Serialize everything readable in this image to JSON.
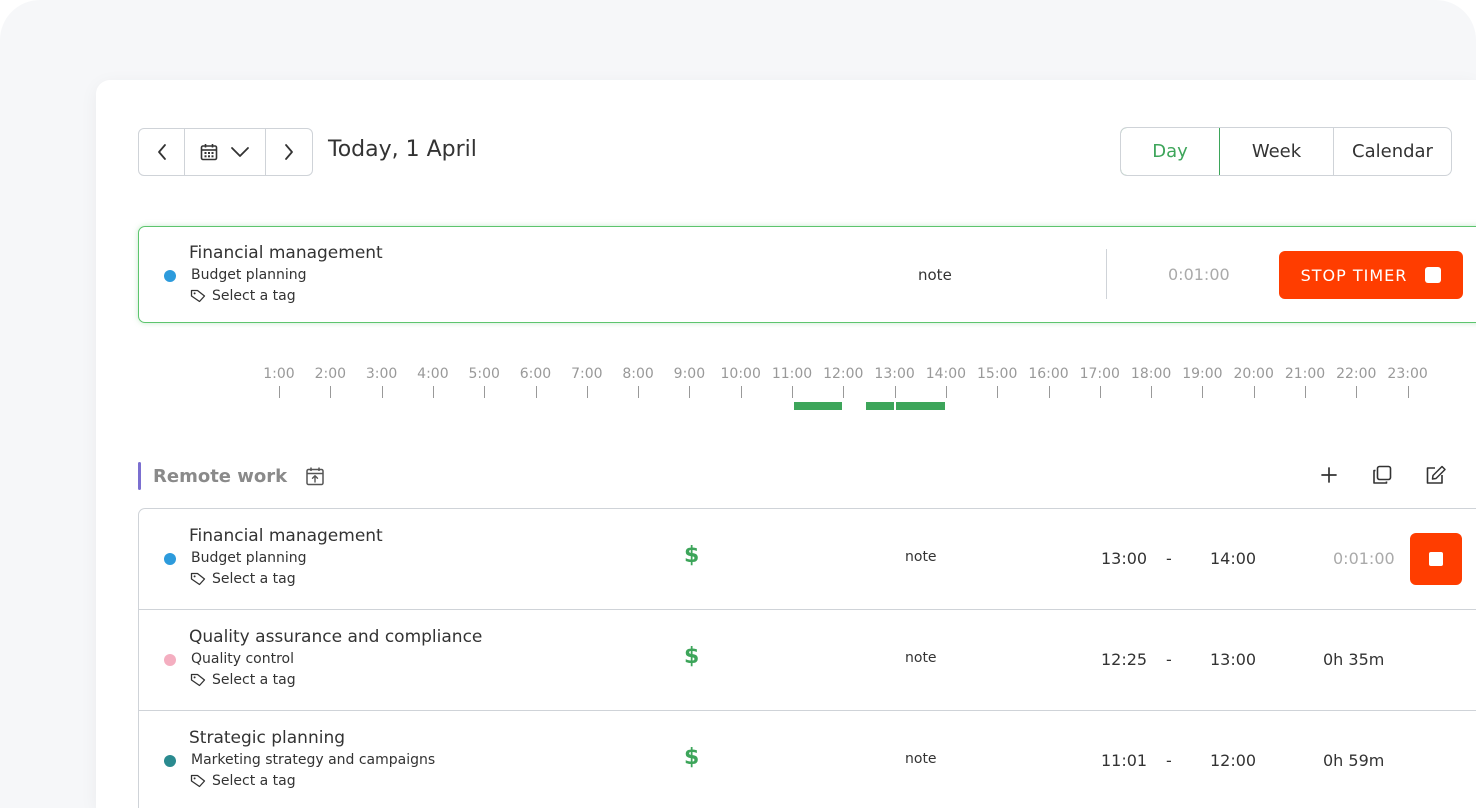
{
  "header": {
    "date_label": "Today, 1 April",
    "views": [
      "Day",
      "Week",
      "Calendar"
    ],
    "active_view": "Day"
  },
  "running_timer": {
    "project": "Financial management",
    "task": "Budget planning",
    "tag_placeholder": "Select a tag",
    "note": "note",
    "elapsed": "0:01:00",
    "stop_label": "STOP TIMER",
    "dot_color": "#2d9bdc"
  },
  "timeline": {
    "hours": [
      "1:00",
      "2:00",
      "3:00",
      "4:00",
      "5:00",
      "6:00",
      "7:00",
      "8:00",
      "9:00",
      "10:00",
      "11:00",
      "12:00",
      "13:00",
      "14:00",
      "15:00",
      "16:00",
      "17:00",
      "18:00",
      "19:00",
      "20:00",
      "21:00",
      "22:00",
      "23:00"
    ]
  },
  "group": {
    "title": "Remote work"
  },
  "entries": [
    {
      "project": "Financial management",
      "task": "Budget planning",
      "tag": "Select a tag",
      "billable": "$",
      "note": "note",
      "start": "13:00",
      "sep": "-",
      "end": "14:00",
      "duration": "0:01:00",
      "running": true,
      "dot_color": "#2d9bdc"
    },
    {
      "project": "Quality assurance and compliance",
      "task": "Quality control",
      "tag": "Select a tag",
      "billable": "$",
      "note": "note",
      "start": "12:25",
      "sep": "-",
      "end": "13:00",
      "duration": "0h 35m",
      "running": false,
      "dot_color": "#f4aec0"
    },
    {
      "project": "Strategic planning",
      "task": "Marketing strategy and campaigns",
      "tag": "Select a tag",
      "billable": "$",
      "note": "note",
      "start": "11:01",
      "sep": "-",
      "end": "12:00",
      "duration": "0h 59m",
      "running": false,
      "dot_color": "#2a8a8f"
    }
  ],
  "colors": {
    "accent": "#3da55a",
    "danger": "#ff3d00",
    "group_bar": "#7b6fd0"
  }
}
